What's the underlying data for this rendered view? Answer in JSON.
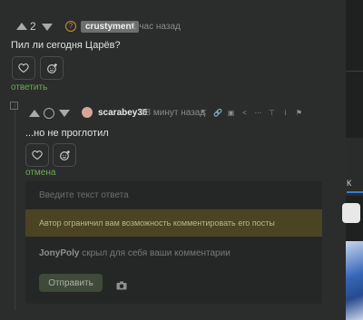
{
  "comment1": {
    "score": "2",
    "author": "crustyment",
    "time": "1 час назад",
    "text": "Пил ли сегодня Царёв?",
    "action": "ответить"
  },
  "comment2": {
    "author": "scarabey36",
    "time": "28 минут назад",
    "text": "...но не проглотил",
    "action": "отмена"
  },
  "reply_form": {
    "placeholder": "Введите текст ответа",
    "notice": "Автор ограничил вам возможность комментировать его посты",
    "hidden_user": "JonyPoly",
    "hidden_text": "скрыл для себя ваши комментарии",
    "submit_label": "Отправить"
  },
  "right_panel": {
    "letter": "К"
  },
  "colors": {
    "background": "#2b2d2c",
    "green_link": "#6ea85a",
    "notice_bg": "#4a4423",
    "submit_bg": "#3f4a3a",
    "badge_bg": "#6c6f6d"
  }
}
